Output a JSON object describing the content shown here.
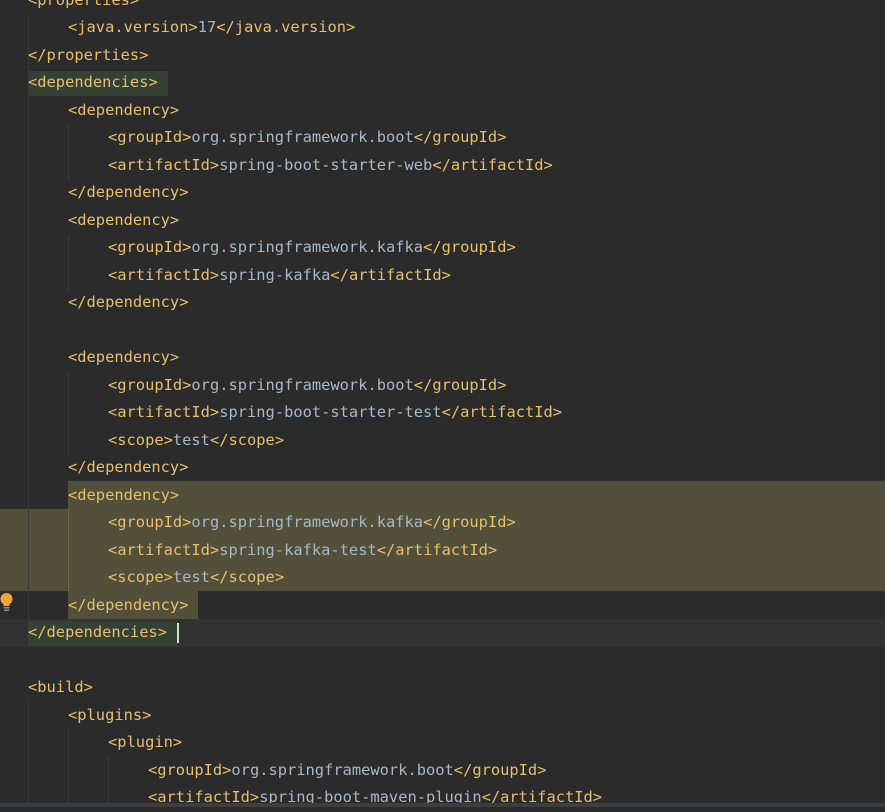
{
  "lines": [
    {
      "indent": 0,
      "parts": [
        {
          "t": "tag",
          "v": "<properties>"
        }
      ]
    },
    {
      "indent": 1,
      "parts": [
        {
          "t": "tag",
          "v": "<java.version>"
        },
        {
          "t": "txt",
          "v": "17"
        },
        {
          "t": "tag",
          "v": "</java.version>"
        }
      ]
    },
    {
      "indent": 0,
      "parts": [
        {
          "t": "tag",
          "v": "</properties>"
        }
      ]
    },
    {
      "indent": 0,
      "parts": [
        {
          "t": "tag",
          "v": "<dependencies>"
        }
      ]
    },
    {
      "indent": 1,
      "parts": [
        {
          "t": "tag",
          "v": "<dependency>"
        }
      ]
    },
    {
      "indent": 2,
      "parts": [
        {
          "t": "tag",
          "v": "<groupId>"
        },
        {
          "t": "txt",
          "v": "org.springframework.boot"
        },
        {
          "t": "tag",
          "v": "</groupId>"
        }
      ]
    },
    {
      "indent": 2,
      "parts": [
        {
          "t": "tag",
          "v": "<artifactId>"
        },
        {
          "t": "txt",
          "v": "spring-boot-starter-web"
        },
        {
          "t": "tag",
          "v": "</artifactId>"
        }
      ]
    },
    {
      "indent": 1,
      "parts": [
        {
          "t": "tag",
          "v": "</dependency>"
        }
      ]
    },
    {
      "indent": 1,
      "parts": [
        {
          "t": "tag",
          "v": "<dependency>"
        }
      ]
    },
    {
      "indent": 2,
      "parts": [
        {
          "t": "tag",
          "v": "<groupId>"
        },
        {
          "t": "txt",
          "v": "org.springframework.kafka"
        },
        {
          "t": "tag",
          "v": "</groupId>"
        }
      ]
    },
    {
      "indent": 2,
      "parts": [
        {
          "t": "tag",
          "v": "<artifactId>"
        },
        {
          "t": "txt",
          "v": "spring-kafka"
        },
        {
          "t": "tag",
          "v": "</artifactId>"
        }
      ]
    },
    {
      "indent": 1,
      "parts": [
        {
          "t": "tag",
          "v": "</dependency>"
        }
      ]
    },
    {
      "indent": 0,
      "parts": []
    },
    {
      "indent": 1,
      "parts": [
        {
          "t": "tag",
          "v": "<dependency>"
        }
      ]
    },
    {
      "indent": 2,
      "parts": [
        {
          "t": "tag",
          "v": "<groupId>"
        },
        {
          "t": "txt",
          "v": "org.springframework.boot"
        },
        {
          "t": "tag",
          "v": "</groupId>"
        }
      ]
    },
    {
      "indent": 2,
      "parts": [
        {
          "t": "tag",
          "v": "<artifactId>"
        },
        {
          "t": "txt",
          "v": "spring-boot-starter-test"
        },
        {
          "t": "tag",
          "v": "</artifactId>"
        }
      ]
    },
    {
      "indent": 2,
      "parts": [
        {
          "t": "tag",
          "v": "<scope>"
        },
        {
          "t": "txt",
          "v": "test"
        },
        {
          "t": "tag",
          "v": "</scope>"
        }
      ]
    },
    {
      "indent": 1,
      "parts": [
        {
          "t": "tag",
          "v": "</dependency>"
        }
      ]
    },
    {
      "indent": 1,
      "parts": [
        {
          "t": "tag",
          "v": "<dependency>"
        }
      ]
    },
    {
      "indent": 2,
      "parts": [
        {
          "t": "tag",
          "v": "<groupId>"
        },
        {
          "t": "txt",
          "v": "org.springframework.kafka"
        },
        {
          "t": "tag",
          "v": "</groupId>"
        }
      ]
    },
    {
      "indent": 2,
      "parts": [
        {
          "t": "tag",
          "v": "<artifactId>"
        },
        {
          "t": "txt",
          "v": "spring-kafka-test"
        },
        {
          "t": "tag",
          "v": "</artifactId>"
        }
      ]
    },
    {
      "indent": 2,
      "parts": [
        {
          "t": "tag",
          "v": "<scope>"
        },
        {
          "t": "txt",
          "v": "test"
        },
        {
          "t": "tag",
          "v": "</scope>"
        }
      ]
    },
    {
      "indent": 1,
      "parts": [
        {
          "t": "tag",
          "v": "</dependency>"
        }
      ]
    },
    {
      "indent": 0,
      "parts": [
        {
          "t": "tag",
          "v": "</dependencies>"
        }
      ]
    },
    {
      "indent": 0,
      "parts": []
    },
    {
      "indent": 0,
      "parts": [
        {
          "t": "tag",
          "v": "<build>"
        }
      ]
    },
    {
      "indent": 1,
      "parts": [
        {
          "t": "tag",
          "v": "<plugins>"
        }
      ]
    },
    {
      "indent": 2,
      "parts": [
        {
          "t": "tag",
          "v": "<plugin>"
        }
      ]
    },
    {
      "indent": 3,
      "parts": [
        {
          "t": "tag",
          "v": "<groupId>"
        },
        {
          "t": "txt",
          "v": "org.springframework.boot"
        },
        {
          "t": "tag",
          "v": "</groupId>"
        }
      ]
    },
    {
      "indent": 3,
      "parts": [
        {
          "t": "tag",
          "v": "<artifactId>"
        },
        {
          "t": "txt",
          "v": "spring-boot-maven-plugin"
        },
        {
          "t": "tag",
          "v": "</artifactId>"
        }
      ]
    }
  ],
  "colors": {
    "background": "#2b2b2b",
    "tag": "#e8bf6a",
    "text": "#a9b7c6",
    "selection": "#52503a",
    "bracket_match": "#344134",
    "intention_bulb": "#f0a732"
  },
  "icons": {
    "intention": "lightbulb-icon"
  }
}
